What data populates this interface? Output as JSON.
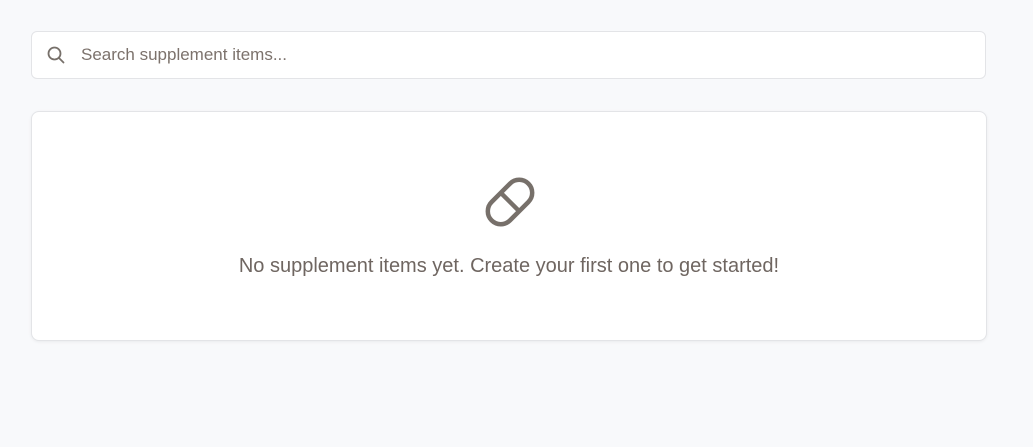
{
  "search": {
    "placeholder": "Search supplement items...",
    "value": ""
  },
  "empty_state": {
    "icon": "pill-icon",
    "message": "No supplement items yet. Create your first one to get started!"
  },
  "colors": {
    "page_background": "#f8f9fb",
    "card_background": "#ffffff",
    "border": "#e3e4e7",
    "icon_color": "#77706a",
    "text_color": "#6f6661"
  }
}
